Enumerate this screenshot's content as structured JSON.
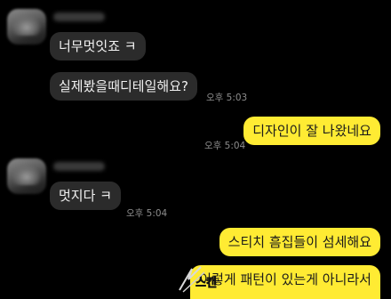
{
  "chat": {
    "messages": [
      {
        "side": "in",
        "text": "너무멋잇죠 ㅋ"
      },
      {
        "side": "in",
        "text": "실제봤을때디테일해요?",
        "time": "오후 5:03"
      },
      {
        "side": "out",
        "text": "디자인이 잘 나왔네요",
        "time": "오후 5:04"
      },
      {
        "side": "in",
        "text": "멋지다 ㅋ",
        "time": "오후 5:04"
      },
      {
        "side": "out",
        "text": "스티치 흠집들이 섬세해요"
      },
      {
        "side": "out",
        "text": "이렇게 패턴이 있는게 아니라서"
      }
    ]
  },
  "colors": {
    "background": "#000000",
    "incoming_bubble": "#2b2b2b",
    "outgoing_bubble": "#ffeb33",
    "time_text": "#8d8d8d"
  },
  "watermark": {
    "text": "스캔"
  }
}
